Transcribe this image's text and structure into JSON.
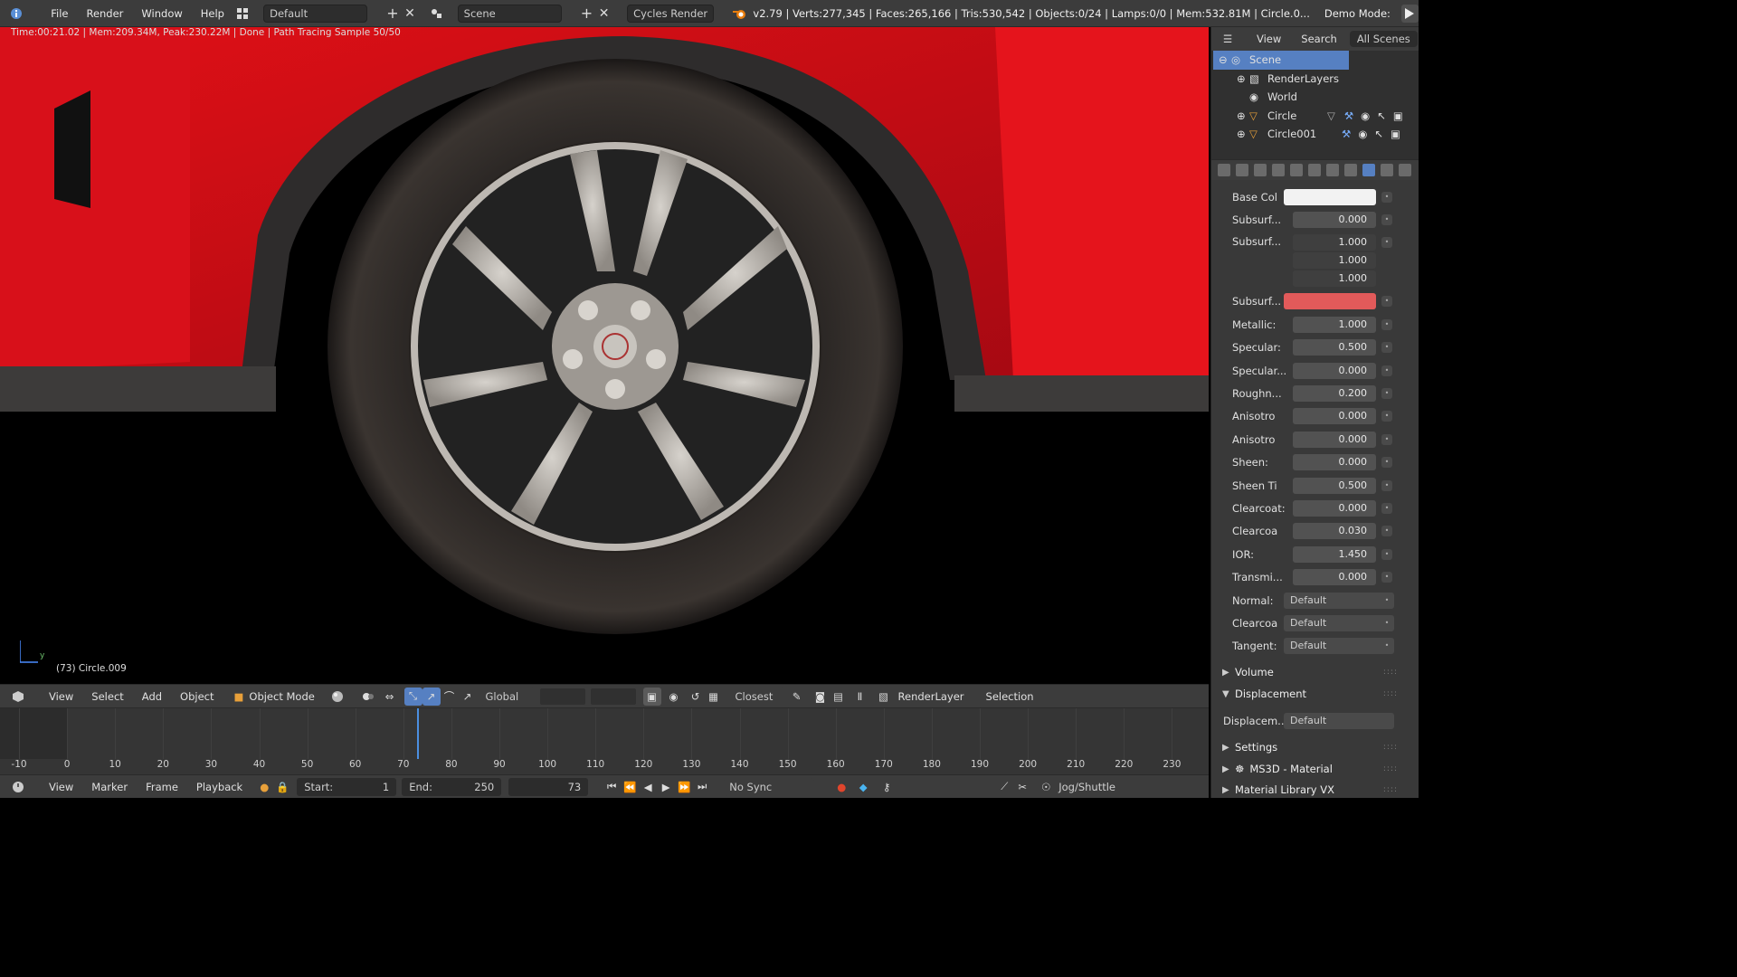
{
  "topbar": {
    "menus": [
      "File",
      "Render",
      "Window",
      "Help"
    ],
    "layout": "Default",
    "scene": "Scene",
    "engine": "Cycles Render",
    "stats": "v2.79 | Verts:277,345 | Faces:265,166 | Tris:530,542 | Objects:0/24 | Lamps:0/0 | Mem:532.81M | Circle.0...",
    "demo": "Demo Mode:"
  },
  "viewport": {
    "status": "Time:00:21.02 | Mem:209.34M, Peak:230.22M | Done | Path Tracing Sample 50/50",
    "object": "(73) Circle.009",
    "axis_y": "y"
  },
  "vheader": {
    "menus": [
      "View",
      "Select",
      "Add",
      "Object"
    ],
    "mode": "Object Mode",
    "orientation": "Global",
    "snap": "Closest",
    "layer": "RenderLayer",
    "selection": "Selection"
  },
  "timeline": {
    "labels": [
      "-10",
      "0",
      "10",
      "20",
      "30",
      "40",
      "50",
      "60",
      "70",
      "80",
      "90",
      "100",
      "110",
      "120",
      "130",
      "140",
      "150",
      "160",
      "170",
      "180",
      "190",
      "200",
      "210",
      "220",
      "230"
    ],
    "current": 73
  },
  "tlheader": {
    "menus": [
      "View",
      "Marker",
      "Frame",
      "Playback"
    ],
    "start_label": "Start:",
    "start": "1",
    "end_label": "End:",
    "end": "250",
    "frame": "73",
    "sync": "No Sync",
    "jog": "Jog/Shuttle"
  },
  "outliner": {
    "tabs": [
      "View",
      "Search",
      "All Scenes"
    ],
    "items": [
      "Scene",
      "RenderLayers",
      "World",
      "Circle",
      "Circle001"
    ]
  },
  "props": {
    "rows": [
      {
        "label": "Base Col",
        "kind": "color",
        "color": "#f2f2f2"
      },
      {
        "label": "Subsurf...",
        "kind": "num",
        "value": "0.000"
      },
      {
        "label": "Subsurf...",
        "kind": "vec",
        "values": [
          "1.000",
          "1.000",
          "1.000"
        ]
      },
      {
        "label": "Subsurf...",
        "kind": "color",
        "color": "#e25a5a"
      },
      {
        "label": "Metallic:",
        "kind": "num",
        "value": "1.000"
      },
      {
        "label": "Specular:",
        "kind": "num",
        "value": "0.500"
      },
      {
        "label": "Specular...",
        "kind": "num",
        "value": "0.000"
      },
      {
        "label": "Roughn...",
        "kind": "num",
        "value": "0.200"
      },
      {
        "label": "Anisotro",
        "kind": "num",
        "value": "0.000"
      },
      {
        "label": "Anisotro",
        "kind": "num",
        "value": "0.000"
      },
      {
        "label": "Sheen:",
        "kind": "num",
        "value": "0.000"
      },
      {
        "label": "Sheen Ti",
        "kind": "num",
        "value": "0.500"
      },
      {
        "label": "Clearcoat:",
        "kind": "num",
        "value": "0.000"
      },
      {
        "label": "Clearcoa",
        "kind": "num",
        "value": "0.030"
      },
      {
        "label": "IOR:",
        "kind": "num",
        "value": "1.450"
      },
      {
        "label": "Transmi...",
        "kind": "num",
        "value": "0.000"
      },
      {
        "label": "Normal:",
        "kind": "dd",
        "value": "Default"
      },
      {
        "label": "Clearcoa",
        "kind": "dd",
        "value": "Default"
      },
      {
        "label": "Tangent:",
        "kind": "dd",
        "value": "Default"
      }
    ],
    "volume": "Volume",
    "displacement": "Displacement",
    "displacement_label": "Displacem...",
    "displacement_value": "Default",
    "settings": "Settings",
    "ms3d": "MS3D - Material",
    "library": "Material Library VX"
  }
}
